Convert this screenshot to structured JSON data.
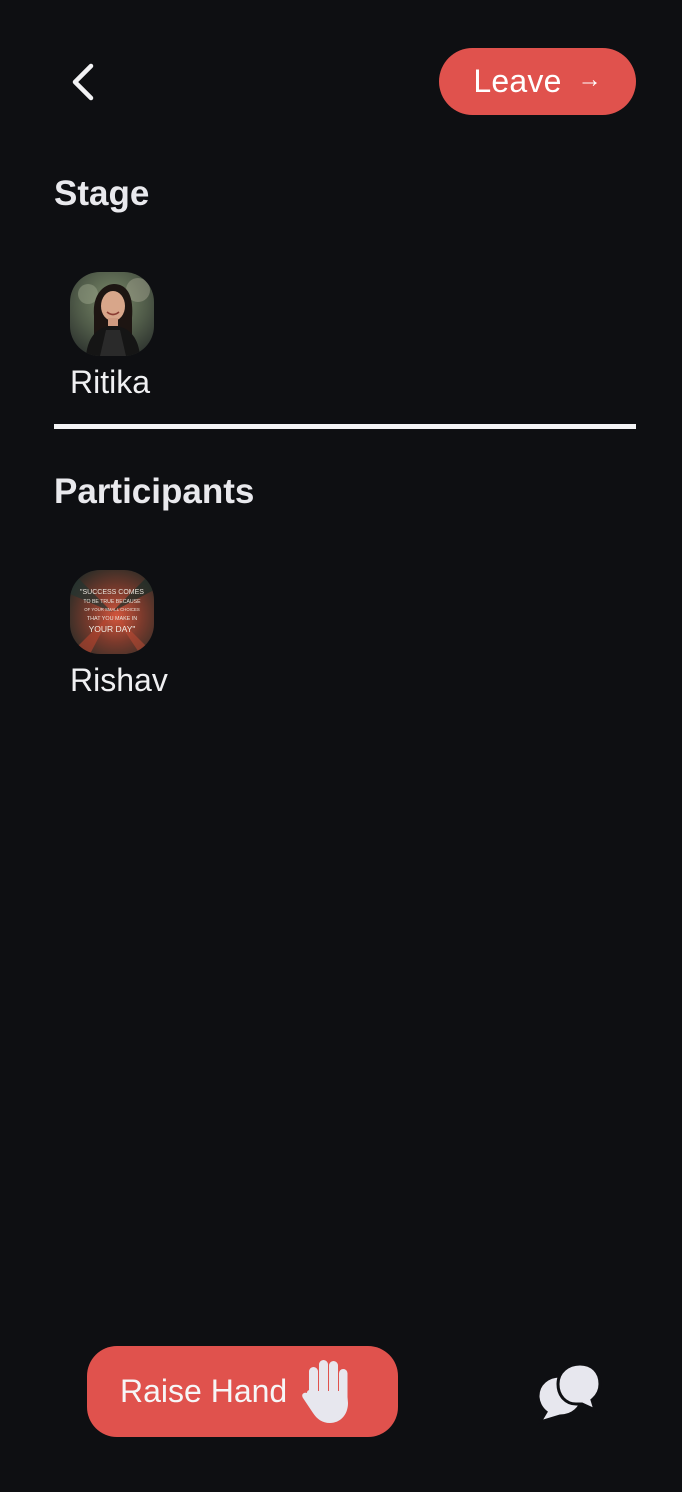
{
  "header": {
    "back_icon": "chevron-left-icon",
    "leave_label": "Leave",
    "leave_icon": "arrow-right-icon",
    "leave_color": "#e0524d"
  },
  "stage": {
    "title": "Stage",
    "members": [
      {
        "name": "Ritika",
        "avatar": "portrait-photo"
      }
    ]
  },
  "participants": {
    "title": "Participants",
    "members": [
      {
        "name": "Rishav",
        "avatar": "quote-image",
        "avatar_text": [
          "\"SUCCESS COMES",
          "TO BE TRUE BECAUSE",
          "OF YOUR SMALL CHOICES",
          "THAT YOU MAKE IN",
          "YOUR DAY\""
        ]
      }
    ]
  },
  "footer": {
    "raise_hand_label": "Raise Hand",
    "raise_hand_icon": "raised-hand-icon",
    "raise_hand_color": "#e0524d",
    "chat_icon": "chat-bubbles-icon"
  },
  "colors": {
    "background": "#0e0f12",
    "accent": "#e0524d",
    "text": "#f2f2f4"
  }
}
